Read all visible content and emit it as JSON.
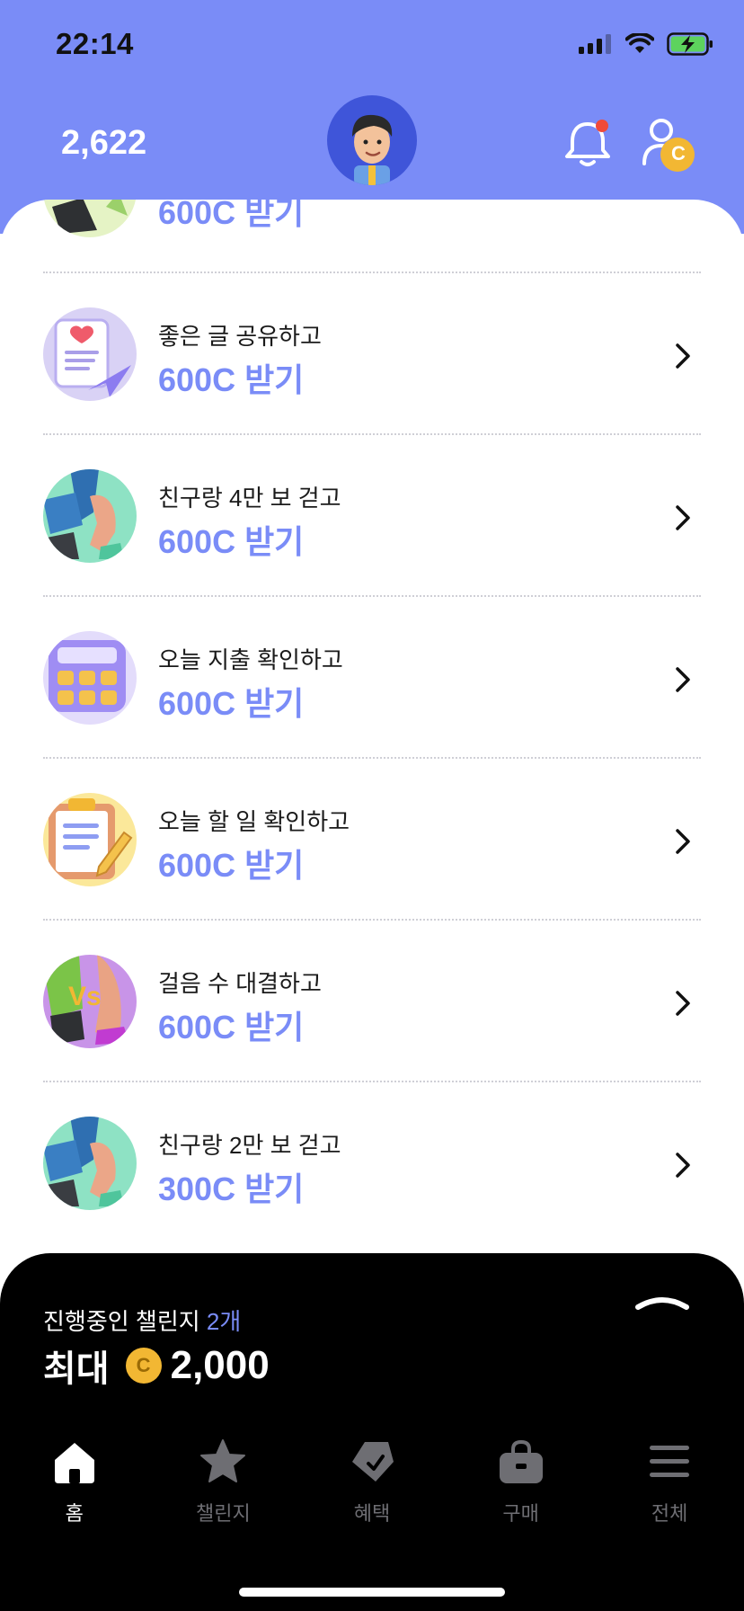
{
  "status_bar": {
    "time": "22:14",
    "icons": [
      "signal-icon",
      "wifi-icon",
      "battery-charging-icon"
    ]
  },
  "header": {
    "points": "2,622",
    "avatar_icon": "character-avatar",
    "notification_icon": "bell-icon",
    "profile_icon": "profile-coin-icon",
    "profile_badge": "C"
  },
  "colors": {
    "accent": "#7a8cf7",
    "header_bg": "#7a8cf7",
    "panel_bg": "#000000",
    "coin": "#f2b733",
    "notification_dot": "#f04a3a"
  },
  "missions": {
    "partial_reward": "600C 받기",
    "items": [
      {
        "title": "좋은 글 공유하고",
        "reward": "600C 받기",
        "icon": "letter-share-icon"
      },
      {
        "title": "친구랑 4만 보 걷고",
        "reward": "600C 받기",
        "icon": "walking-legs-icon"
      },
      {
        "title": "오늘 지출 확인하고",
        "reward": "600C 받기",
        "icon": "calculator-icon"
      },
      {
        "title": "오늘 할 일 확인하고",
        "reward": "600C 받기",
        "icon": "clipboard-icon"
      },
      {
        "title": "걸음 수 대결하고",
        "reward": "600C 받기",
        "icon": "vs-legs-icon"
      },
      {
        "title": "친구랑 2만 보 걷고",
        "reward": "300C 받기",
        "icon": "walking-legs-icon"
      }
    ]
  },
  "challenge_panel": {
    "label": "진행중인 챌린지",
    "count": "2개",
    "max_label": "최대",
    "coin_symbol": "C",
    "max_amount": "2,000"
  },
  "tabs": [
    {
      "label": "홈",
      "icon": "home-icon",
      "active": true
    },
    {
      "label": "챌린지",
      "icon": "star-icon",
      "active": false
    },
    {
      "label": "혜택",
      "icon": "tag-icon",
      "active": false
    },
    {
      "label": "구매",
      "icon": "shopping-bag-icon",
      "active": false
    },
    {
      "label": "전체",
      "icon": "menu-icon",
      "active": false
    }
  ]
}
